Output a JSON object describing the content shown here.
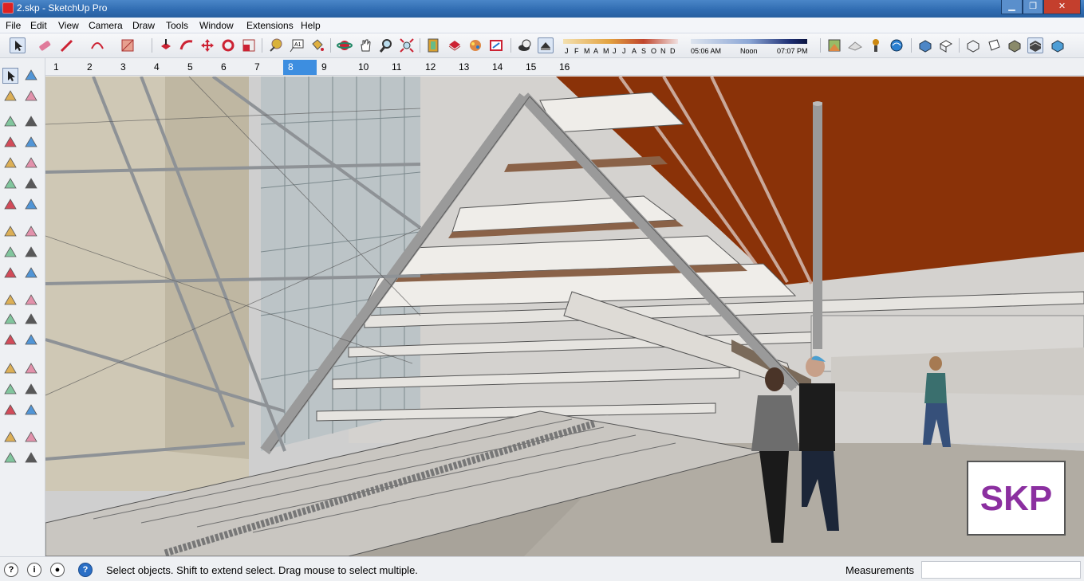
{
  "window": {
    "title": "2.skp - SketchUp Pro",
    "minimize": "▁",
    "maximize": "❐",
    "close": "✕"
  },
  "menu": {
    "items": [
      "File",
      "Edit",
      "View",
      "Camera",
      "Draw",
      "Tools",
      "Window",
      "Extensions",
      "Help"
    ]
  },
  "shadow": {
    "months": [
      "J",
      "F",
      "M",
      "A",
      "M",
      "J",
      "J",
      "A",
      "S",
      "O",
      "N",
      "D"
    ],
    "time_start": "05:06 AM",
    "time_mid": "Noon",
    "time_end": "07:07 PM"
  },
  "scenes": {
    "tabs": [
      "1",
      "2",
      "3",
      "4",
      "5",
      "6",
      "7",
      "8",
      "9",
      "10",
      "11",
      "12",
      "13",
      "14",
      "15",
      "16"
    ],
    "active": "8"
  },
  "toolbar_icons": [
    "select-icon",
    "eraser-icon",
    "pencil-icon",
    "arc-icon",
    "rectangle-icon",
    "push-pull-icon",
    "follow-me-icon",
    "move-icon",
    "rotate-icon",
    "scale-icon",
    "tape-measure-icon",
    "text-icon",
    "paint-bucket-icon",
    "orbit-icon",
    "pan-icon",
    "zoom-icon",
    "zoom-extents-icon",
    "section-icon",
    "components-icon",
    "materials-icon",
    "styles-icon",
    "shadows-icon",
    "fog-icon"
  ],
  "left_tools": [
    "select-icon",
    "component-icon",
    "paint-bucket-icon",
    "eraser-icon",
    "line-icon",
    "freehand-icon",
    "rectangle-icon",
    "rotated-rectangle-icon",
    "circle-icon",
    "polygon-icon",
    "arc-icon",
    "pie-icon",
    "two-point-arc-icon",
    "three-point-arc-icon",
    "move-icon",
    "push-pull-icon",
    "rotate-icon",
    "follow-me-icon",
    "scale-icon",
    "offset-icon",
    "tape-measure-icon",
    "dimension-icon",
    "protractor-icon",
    "text-icon",
    "axes-icon",
    "3d-text-icon",
    "orbit-icon",
    "pan-icon",
    "zoom-icon",
    "zoom-window-icon",
    "zoom-extents-icon",
    "previous-view-icon",
    "position-camera-icon",
    "look-around-icon",
    "walk-icon",
    "section-plane-icon"
  ],
  "status": {
    "text": "Select objects. Shift to extend select. Drag mouse to select multiple.",
    "measurements_label": "Measurements",
    "measurements_value": ""
  },
  "watermark": "SKP",
  "colors": {
    "accent": "#3d8ee0",
    "roof": "#8a3208",
    "titlebar": "#2f6bb0"
  }
}
